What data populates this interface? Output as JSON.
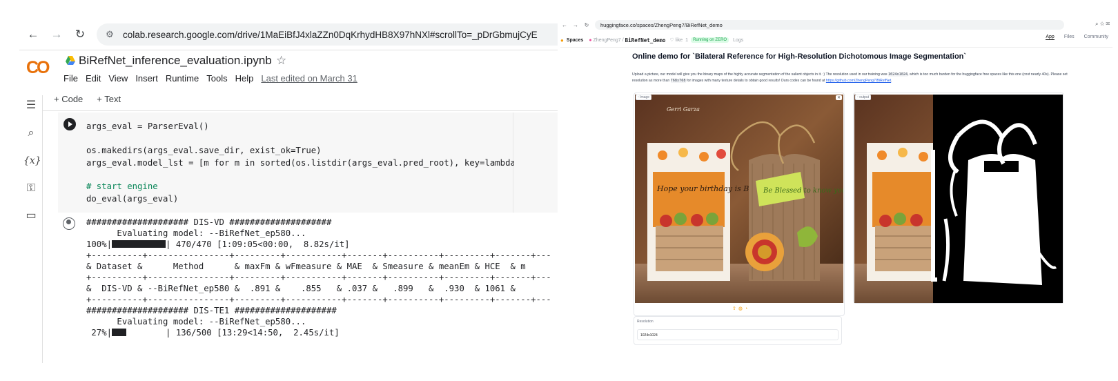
{
  "colab": {
    "url": "colab.research.google.com/drive/1MaEiBfJ4xlaZZn0DqKrhydHB8X97hNXl#scrollTo=_pDrGbmujCyE",
    "logo": "CO",
    "notebook_title": "BiRefNet_inference_evaluation.ipynb",
    "menu": [
      "File",
      "Edit",
      "View",
      "Insert",
      "Runtime",
      "Tools",
      "Help"
    ],
    "last_edited": "Last edited on March 31",
    "toolbar": {
      "code_label": "+ Code",
      "text_label": "+ Text"
    },
    "code_lines": [
      "args_eval = ParserEval()",
      "os.makedirs(args_eval.save_dir, exist_ok=True)",
      "args_eval.model_lst = [m for m in sorted(os.listdir(args_eval.pred_root), key=lambda x",
      "# start engine",
      "do_eval(args_eval)"
    ],
    "output_lines": [
      "#################### DIS-VD ####################",
      "      Evaluating model: --BiRefNet_ep580...",
      "470/470 [1:09:05<00:00,  8.82s/it]",
      "+----------+----------------+---------+-----------+-------+----------+---------+-------+---",
      "& Dataset &      Method      & maxFm & wFmeasure & MAE  & Smeasure & meanEm & HCE  & m",
      "+----------+----------------+---------+-----------+-------+----------+---------+-------+---",
      "&  DIS-VD & --BiRefNet_ep580 &  .891 &    .855   & .037 &   .899   &  .930  & 1061 &",
      "+----------+----------------+---------+-----------+-------+----------+---------+-------+---",
      "#################### DIS-TE1 ####################",
      "      Evaluating model: --BiRefNet_ep580...",
      "136/500 [13:29<14:50,  2.45s/it]"
    ],
    "progress_1": {
      "percent_label": "100%|",
      "fraction": 1.0
    },
    "progress_2": {
      "percent_label": " 27%|",
      "fraction": 0.27
    }
  },
  "hf": {
    "url": "huggingface.co/spaces/ZhengPeng7/BiRefNet_demo",
    "spaces_label": "Spaces",
    "owner": "ZhengPeng7",
    "space_name": "BiRefNet_demo",
    "like_label": "like",
    "like_count": "1",
    "status_badge": "Running on ZERO",
    "logs_label": "Logs",
    "tabs": [
      "App",
      "Files",
      "Community"
    ],
    "page_title": "Online demo for `Bilateral Reference for High-Resolution Dichotomous Image Segmentation`",
    "description_1": "Upload a picture, our model will give you the binary maps of the highly accurate segmentation of the salient objects in it. :) The resolution used in our training was",
    "res_code": "1024x1024",
    "description_2": ", which is too much burden for the huggingface free spaces like this one (cost nearly 40s). Please set resolution as more than",
    "res_code_2": "768x768",
    "description_3": "for images with many texture details to obtain good results! Ours codes can be found at",
    "link": "https://github.com/ZhengPeng7/BiRefNet",
    "image_label": "Image",
    "output_label": "output",
    "resolution_label": "Resolution",
    "resolution_value": "1024x1024",
    "image_caption_1": "Gerri Garza",
    "image_caption_2": "Hope your birthday is Bushels of fun!",
    "image_caption_3": "Be Blessed to know you"
  }
}
